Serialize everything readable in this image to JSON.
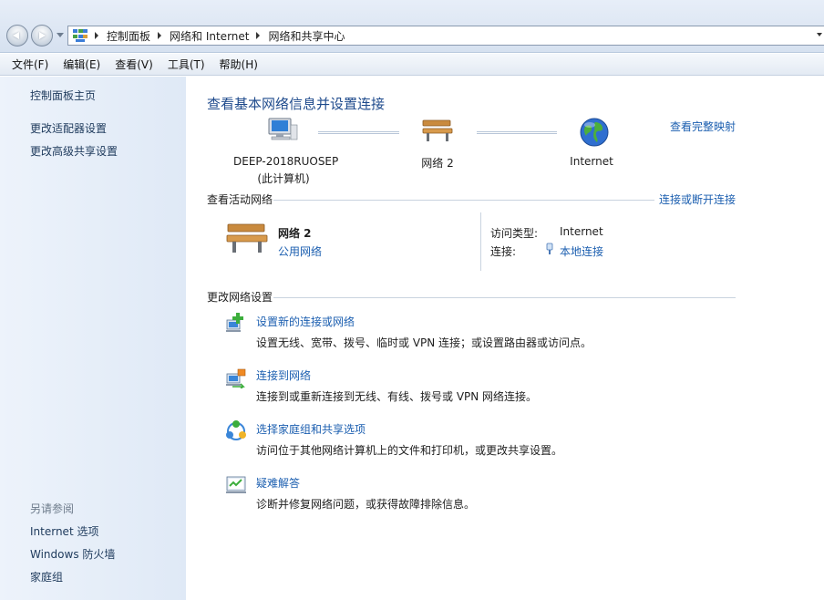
{
  "address": {
    "crumbs": [
      "控制面板",
      "网络和 Internet",
      "网络和共享中心"
    ]
  },
  "menu": [
    "文件(F)",
    "编辑(E)",
    "查看(V)",
    "工具(T)",
    "帮助(H)"
  ],
  "sidebar": {
    "home": "控制面板主页",
    "links": [
      "更改适配器设置",
      "更改高级共享设置"
    ],
    "see_also_title": "另请参阅",
    "see_also": [
      "Internet 选项",
      "Windows 防火墙",
      "家庭组"
    ]
  },
  "main": {
    "title": "查看基本网络信息并设置连接",
    "full_map": "查看完整映射",
    "nodes": {
      "computer_name": "DEEP-2018RUOSEP",
      "computer_sub": "(此计算机)",
      "network": "网络  2",
      "internet": "Internet"
    },
    "active": {
      "heading": "查看活动网络",
      "connect_link": "连接或断开连接",
      "network_name": "网络  2",
      "network_type": "公用网络",
      "access_key": "访问类型:",
      "access_val": "Internet",
      "conn_key": "连接:",
      "conn_val": "本地连接"
    },
    "change": {
      "heading": "更改网络设置",
      "tasks": [
        {
          "link": "设置新的连接或网络",
          "desc": "设置无线、宽带、拨号、临时或 VPN 连接；或设置路由器或访问点。"
        },
        {
          "link": "连接到网络",
          "desc": "连接到或重新连接到无线、有线、拨号或 VPN 网络连接。"
        },
        {
          "link": "选择家庭组和共享选项",
          "desc": "访问位于其他网络计算机上的文件和打印机，或更改共享设置。"
        },
        {
          "link": "疑难解答",
          "desc": "诊断并修复网络问题，或获得故障排除信息。"
        }
      ]
    }
  }
}
